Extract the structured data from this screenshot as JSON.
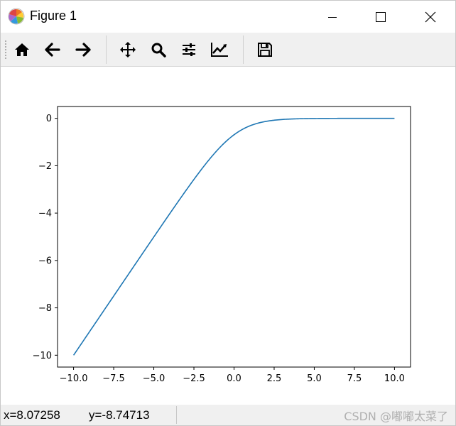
{
  "window": {
    "title": "Figure 1"
  },
  "toolbar": {
    "buttons": [
      {
        "name": "home",
        "icon": "home-icon"
      },
      {
        "name": "back",
        "icon": "arrow-left-icon"
      },
      {
        "name": "forward",
        "icon": "arrow-right-icon"
      },
      {
        "name": "pan",
        "icon": "move-icon"
      },
      {
        "name": "zoom",
        "icon": "magnifier-icon"
      },
      {
        "name": "configure-subplots",
        "icon": "sliders-icon"
      },
      {
        "name": "edit-axis",
        "icon": "line-chart-icon"
      },
      {
        "name": "save",
        "icon": "floppy-disk-icon"
      }
    ]
  },
  "status": {
    "x_readout": "x=8.07258",
    "y_readout": "y=-8.74713",
    "watermark": "CSDN @嘟嘟太菜了"
  },
  "colors": {
    "line": "#1f77b4",
    "axes": "#000000"
  },
  "chart_data": {
    "type": "line",
    "title": "",
    "xlabel": "",
    "ylabel": "",
    "xlim": [
      -11,
      11
    ],
    "ylim": [
      -10.5,
      0.5
    ],
    "xticks": [
      -10,
      -7.5,
      -5,
      -2.5,
      0,
      2.5,
      5,
      7.5,
      10
    ],
    "xtick_labels": [
      "−10.0",
      "−7.5",
      "−5.0",
      "−2.5",
      "0.0",
      "2.5",
      "5.0",
      "7.5",
      "10.0"
    ],
    "yticks": [
      0,
      -2,
      -4,
      -6,
      -8,
      -10
    ],
    "ytick_labels": [
      "0",
      "−2",
      "−4",
      "−6",
      "−8",
      "−10"
    ],
    "grid": false,
    "series": [
      {
        "function": "-log(1+exp(-x))",
        "x": [
          -10,
          -8,
          -6,
          -5,
          -4,
          -3,
          -2,
          -1.5,
          -1,
          -0.5,
          0,
          0.5,
          1,
          1.5,
          2,
          2.5,
          3,
          4,
          5,
          6,
          8,
          10
        ],
        "values": [
          -10.0,
          -8.0,
          -6.0,
          -5.01,
          -4.02,
          -3.05,
          -2.13,
          -1.7,
          -1.31,
          -0.97,
          -0.69,
          -0.47,
          -0.31,
          -0.2,
          -0.13,
          -0.08,
          -0.05,
          -0.02,
          -0.01,
          0.0,
          0.0,
          0.0
        ]
      }
    ]
  }
}
